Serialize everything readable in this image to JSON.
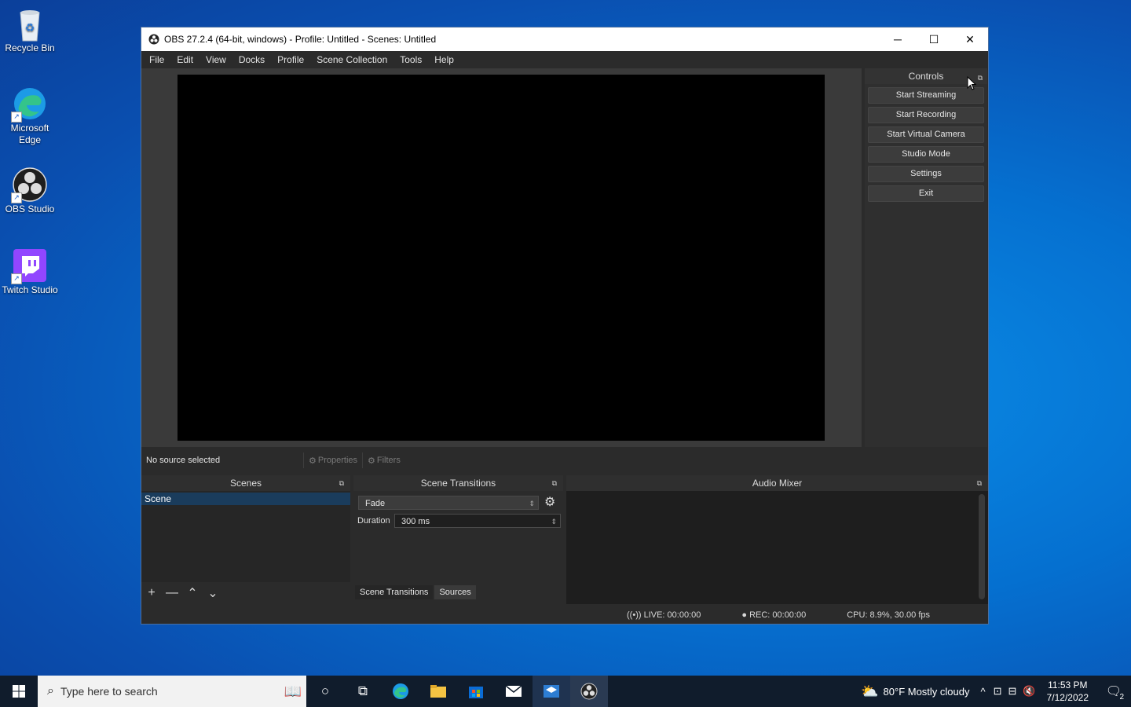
{
  "desktop": {
    "icons": [
      {
        "label": "Recycle Bin",
        "icon": "recycle-bin-icon"
      },
      {
        "label": "Microsoft Edge",
        "icon": "edge-icon"
      },
      {
        "label": "OBS Studio",
        "icon": "obs-icon"
      },
      {
        "label": "Twitch Studio",
        "icon": "twitch-icon"
      }
    ]
  },
  "window": {
    "title": "OBS 27.2.4 (64-bit, windows) - Profile: Untitled - Scenes: Untitled",
    "controls": {
      "minimize": "─",
      "maximize": "☐",
      "close": "✕"
    }
  },
  "menu": [
    "File",
    "Edit",
    "View",
    "Docks",
    "Profile",
    "Scene Collection",
    "Tools",
    "Help"
  ],
  "controls_dock": {
    "title": "Controls",
    "buttons": [
      "Start Streaming",
      "Start Recording",
      "Start Virtual Camera",
      "Studio Mode",
      "Settings",
      "Exit"
    ]
  },
  "source_bar": {
    "status": "No source selected",
    "properties": "Properties",
    "filters": "Filters"
  },
  "scenes_dock": {
    "title": "Scenes",
    "items": [
      "Scene"
    ],
    "tools": [
      "+",
      "—",
      "⌃",
      "⌄"
    ]
  },
  "transitions_dock": {
    "title": "Scene Transitions",
    "transition": "Fade",
    "duration_label": "Duration",
    "duration_value": "300 ms",
    "tabs": [
      "Scene Transitions",
      "Sources"
    ]
  },
  "audio_dock": {
    "title": "Audio Mixer"
  },
  "status": {
    "live": "LIVE: 00:00:00",
    "rec": "REC: 00:00:00",
    "cpu": "CPU: 8.9%, 30.00 fps"
  },
  "taskbar": {
    "search_placeholder": "Type here to search",
    "weather": "80°F  Mostly cloudy",
    "time": "11:53 PM",
    "date": "7/12/2022",
    "notifications": "2"
  },
  "colors": {
    "selected_scene": "#1a3c5c",
    "window_bg": "#2b2b2b"
  }
}
